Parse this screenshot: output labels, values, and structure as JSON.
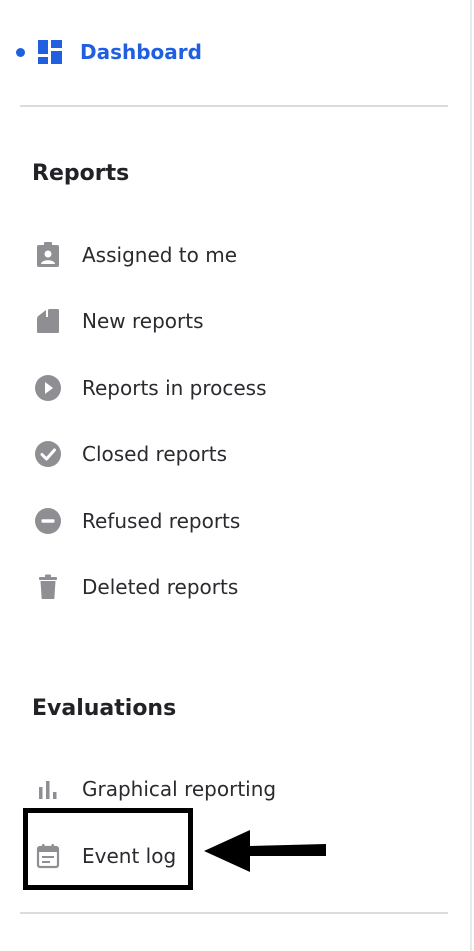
{
  "sidebar": {
    "dashboard": {
      "label": "Dashboard",
      "icon": "dashboard-icon",
      "active": true,
      "color": "#1f5fe0"
    },
    "reports": {
      "title": "Reports",
      "items": [
        {
          "label": "Assigned to me",
          "icon": "assigned-badge-icon"
        },
        {
          "label": "New reports",
          "icon": "new-report-icon"
        },
        {
          "label": "Reports in process",
          "icon": "play-circle-icon"
        },
        {
          "label": "Closed reports",
          "icon": "check-circle-icon"
        },
        {
          "label": "Refused reports",
          "icon": "minus-circle-icon"
        },
        {
          "label": "Deleted reports",
          "icon": "trash-icon"
        }
      ]
    },
    "evaluations": {
      "title": "Evaluations",
      "items": [
        {
          "label": "Graphical reporting",
          "icon": "bar-chart-icon"
        },
        {
          "label": "Event log",
          "icon": "calendar-icon"
        }
      ]
    }
  },
  "annotation": {
    "highlighted_item": "Event log",
    "arrow_icon": "arrow-left-icon",
    "color": "#000000"
  },
  "colors": {
    "icon_gray": "#8e8e93",
    "text": "#2b2b2f",
    "accent": "#1f5fe0"
  }
}
